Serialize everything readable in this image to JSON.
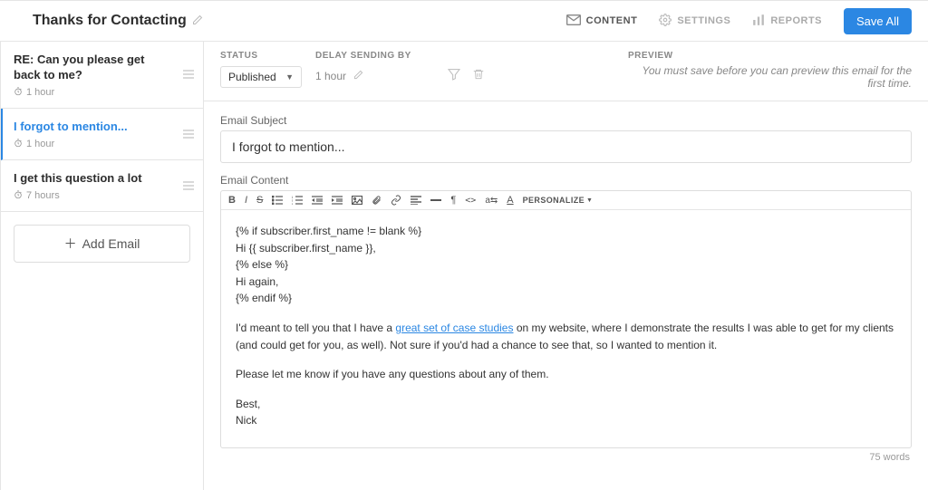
{
  "header": {
    "title": "Thanks for Contacting",
    "nav_content": "CONTENT",
    "nav_settings": "SETTINGS",
    "nav_reports": "REPORTS",
    "save_all": "Save All"
  },
  "sidebar": {
    "items": [
      {
        "label": "RE: Can you please get back to me?",
        "delay": "1 hour",
        "active": false
      },
      {
        "label": "I forgot to mention...",
        "delay": "1 hour",
        "active": true
      },
      {
        "label": "I get this question a lot",
        "delay": "7 hours",
        "active": false
      }
    ],
    "add_email": "Add Email"
  },
  "top": {
    "status_label": "STATUS",
    "status_value": "Published",
    "delay_label": "DELAY SENDING BY",
    "delay_value": "1 hour",
    "preview_label": "PREVIEW",
    "preview_text": "You must save before you can preview this email for the first time."
  },
  "form": {
    "subject_label": "Email Subject",
    "subject_value": "I forgot to mention...",
    "content_label": "Email Content",
    "personalize": "PERSONALIZE",
    "body_lines": {
      "l1": "{% if subscriber.first_name != blank %}",
      "l2": "Hi {{ subscriber.first_name }},",
      "l3": "{% else %}",
      "l4": "Hi again,",
      "l5": "{% endif %}",
      "p1a": "I'd meant to tell you that I have a ",
      "p1link": "great set of case studies",
      "p1b": " on my website, where I demonstrate the results I was able to get for my clients (and could get for you, as well). Not sure if you'd had a chance to see that, so I wanted to mention it.",
      "p2": "Please let me know if you have any questions about any of them.",
      "p3": "Best,",
      "p4": "Nick"
    },
    "word_count": "75 words"
  }
}
